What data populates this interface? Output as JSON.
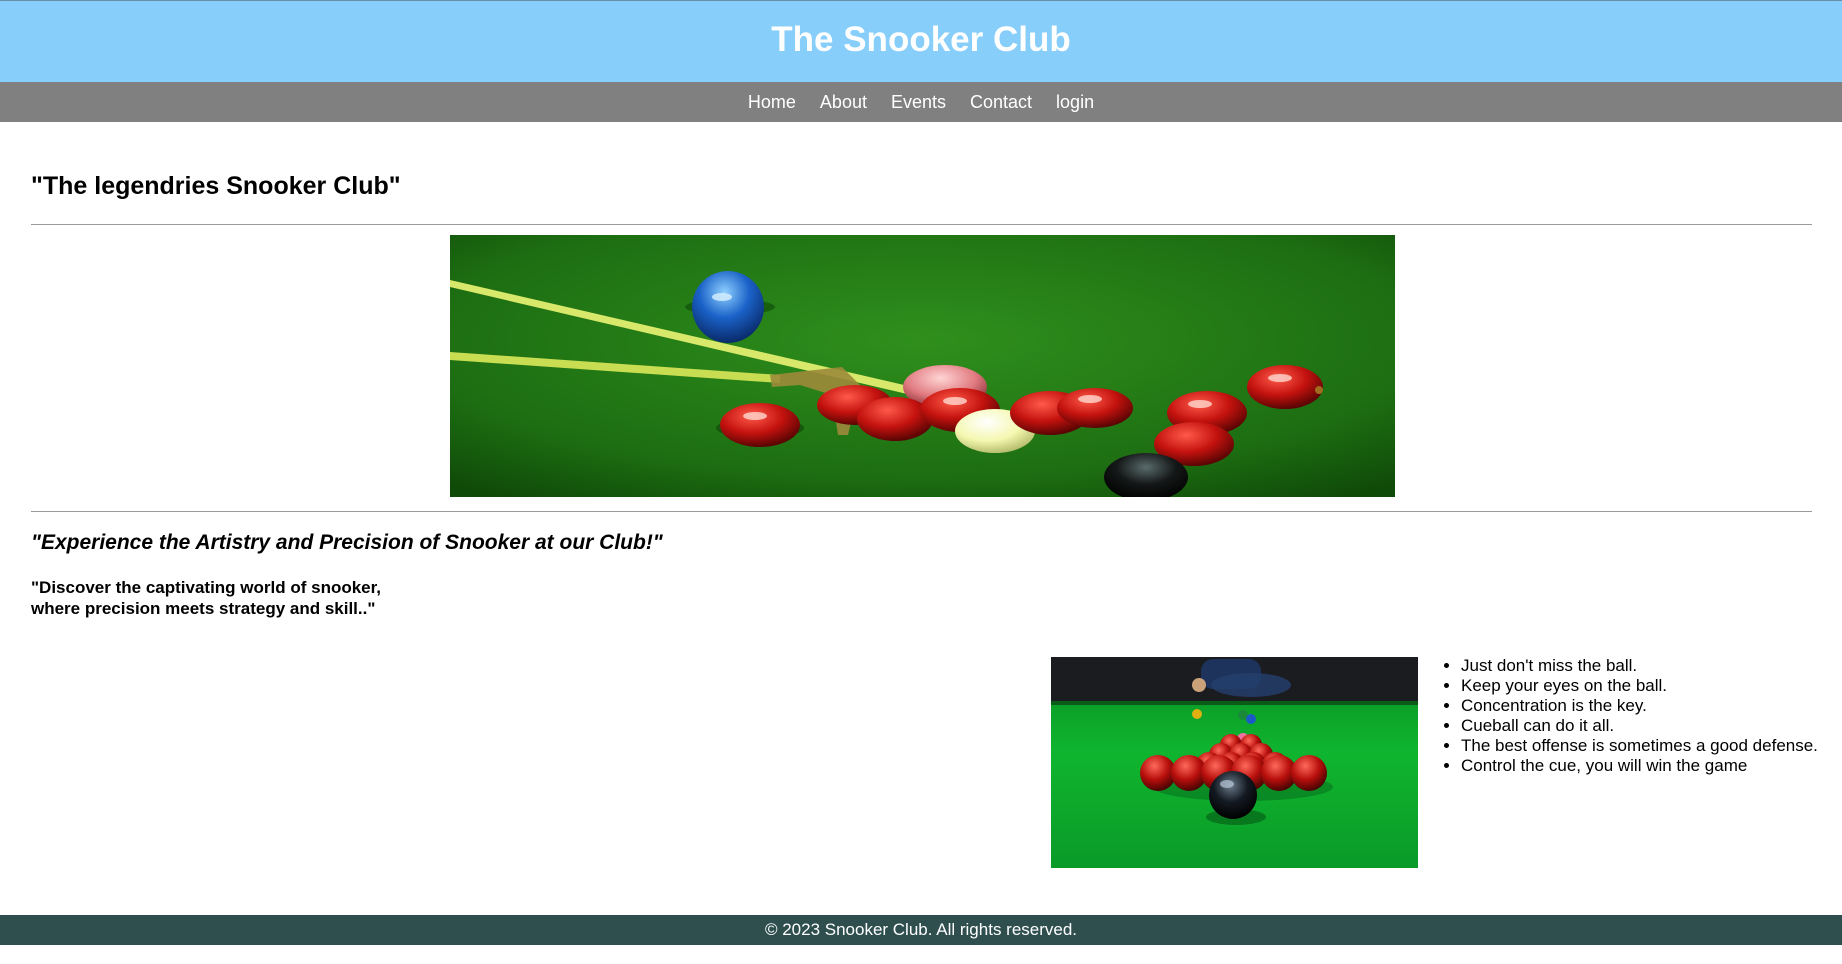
{
  "header": {
    "title": "The Snooker Club"
  },
  "nav": {
    "items": [
      "Home",
      "About",
      "Events",
      "Contact",
      "login"
    ]
  },
  "main": {
    "heading": "\"The legendries Snooker Club\"",
    "tagline": "\"Experience the Artistry and Precision of Snooker at our Club!\"",
    "intro_lines": [
      "\"Discover the captivating world of snooker,",
      "where precision meets strategy and skill..\""
    ],
    "tips": [
      "Just don't miss the ball.",
      "Keep your eyes on the ball.",
      "Concentration is the key.",
      "Cueball can do it all.",
      "The best offense is sometimes a good defense.",
      "Control the cue, you will win the game"
    ]
  },
  "footer": {
    "text": "© 2023 Snooker Club. All rights reserved."
  },
  "colors": {
    "header_bg": "#87cefa",
    "nav_bg": "#808080",
    "footer_bg": "#2f4f4f",
    "felt_green": "#1f7a14",
    "bright_felt": "#0fb52e",
    "red_ball": "#c4120e"
  }
}
